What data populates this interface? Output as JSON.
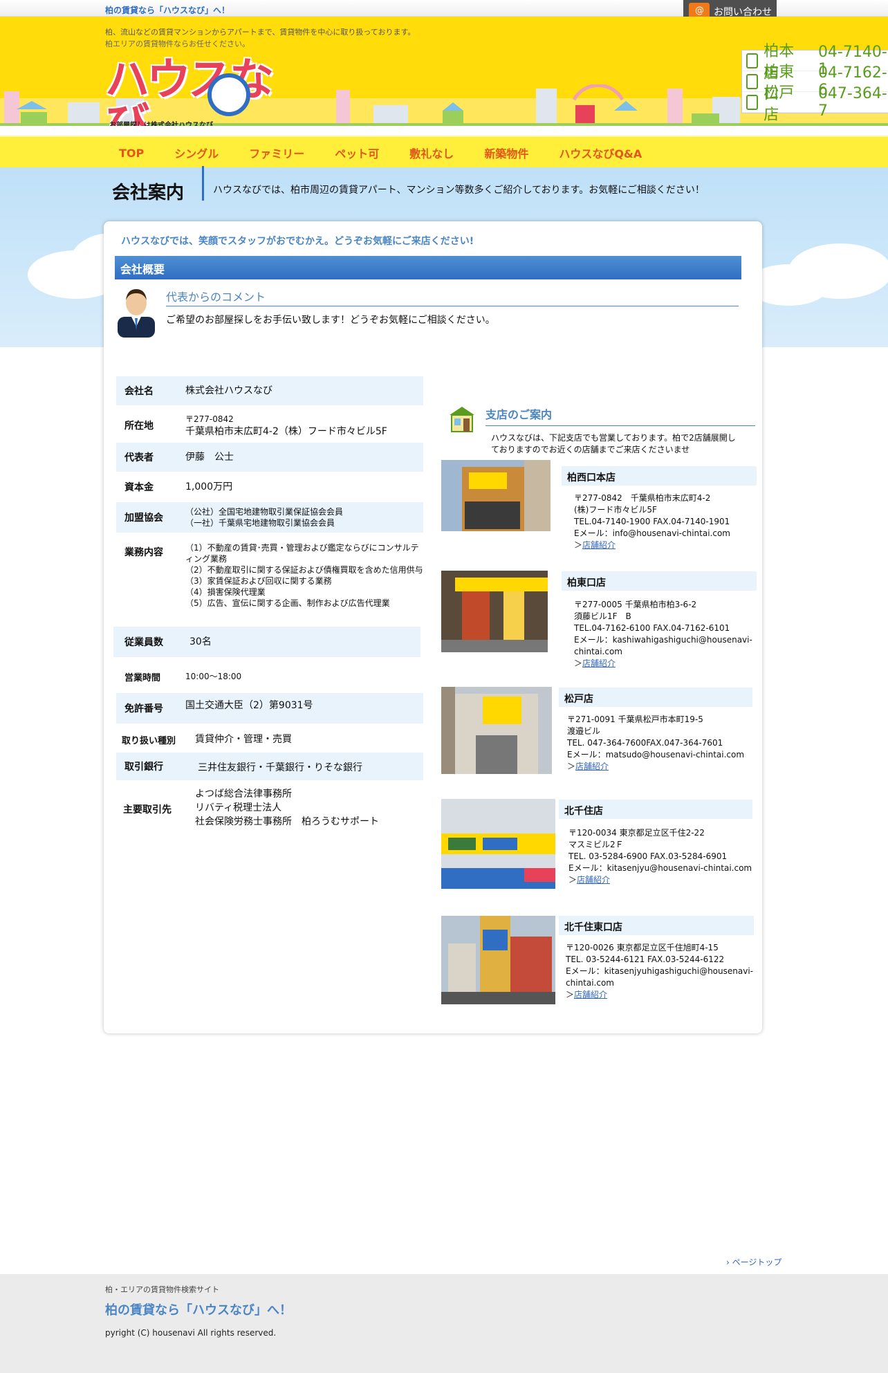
{
  "top": {
    "tagline": "柏の賃貸なら「ハウスなび」へ！",
    "contact_label": "お問い合わせ"
  },
  "header": {
    "desc1": "柏、流山などの賃貸マンションからアパートまで、賃貸物件を中心に取り扱っております。",
    "desc2": "柏エリアの賃貸物件ならお任せください。",
    "logo_text": "ハウスなび",
    "logo_sub": "お部屋探しは株式会社ハウスなび",
    "phones": [
      {
        "store": "柏本店",
        "tel": "04-7140-1"
      },
      {
        "store": "柏東口",
        "tel": "04-7162-6"
      },
      {
        "store": "松戸店",
        "tel": "047-364-7"
      }
    ]
  },
  "nav": [
    "TOP",
    "シングル",
    "ファミリー",
    "ペット可",
    "敷礼なし",
    "新築物件",
    "ハウスなびQ&A"
  ],
  "page": {
    "title": "会社案内",
    "desc": "ハウスなびでは、柏市周辺の賃貸アパート、マンション等数多くご紹介しております。お気軽にご相談ください！",
    "welcome": "ハウスなびでは、笑顔でスタッフがおでむかえ。どうぞお気軽にご来店ください!",
    "section": "会社概要"
  },
  "comment": {
    "title": "代表からのコメント",
    "text": "ご希望のお部屋探しをお手伝い致します！どうぞお気軽にご相談ください。"
  },
  "company": {
    "name_k": "会社名",
    "name_v": "株式会社ハウスなび",
    "addr_k": "所在地",
    "addr_zip": "〒277-0842",
    "addr_v": "千葉県柏市末広町4-2（株）フード市々ビル5F",
    "rep_k": "代表者",
    "rep_v": "伊藤　公士",
    "cap_k": "資本金",
    "cap_v": "1,000万円",
    "assoc_k": "加盟協会",
    "assoc_v1": "（公社）全国宅地建物取引業保証協会会員",
    "assoc_v2": "（一社）千葉県宅地建物取引業協会会員",
    "biz_k": "業務内容",
    "biz_v": [
      "（1）不動産の賃貸･売買・管理および鑑定ならびにコンサルティング業務",
      "（2）不動産取引に関する保証および債権買取を含めた信用供与",
      "（3）家賃保証および回収に関する業務",
      "（4）損害保険代理業",
      "（5）広告、宣伝に関する企画、制作および広告代理業"
    ],
    "emp_k": "従業員数",
    "emp_v": "30名",
    "hours_k": "営業時間",
    "hours_v": "10:00〜18:00",
    "lic_k": "免許番号",
    "lic_v": "国土交通大臣（2）第9031号",
    "type_k": "取り扱い種別",
    "type_v": "賃貸仲介・管理・売買",
    "bank_k": "取引銀行",
    "bank_v": "三井住友銀行・千葉銀行・りそな銀行",
    "partner_k": "主要取引先",
    "partner_v": [
      "よつば総合法律事務所",
      "リバティ税理士法人",
      "社会保険労務士事務所　柏ろうむサポート"
    ]
  },
  "branches": {
    "title": "支店のご案内",
    "desc": "ハウスなびは、下記支店でも営業しております。柏で2店舗展開しておりますのでお近くの店舗までご来店くださいませ",
    "items": [
      {
        "name": "柏西口本店",
        "lines": [
          "〒277-0842　千葉県柏市末広町4-2",
          "(株)フード市々ビル5F",
          "TEL.04-7140-1900 FAX.04-7140-1901",
          "Eメール：info@housenavi-chintai.com"
        ],
        "link": "店舗紹介"
      },
      {
        "name": "柏東口店",
        "lines": [
          "〒277-0005 千葉県柏市柏3-6-2",
          "須藤ビル1F　B",
          "TEL.04-7162-6100 FAX.04-7162-6101",
          "Eメール：kashiwahigashiguchi@housenavi-chintai.com"
        ],
        "link": "店舗紹介"
      },
      {
        "name": "松戸店",
        "lines": [
          "〒271-0091 千葉県松戸市本町19-5",
          "渡邉ビル",
          "TEL. 047-364-7600FAX.047-364-7601",
          "Eメール：matsudo@housenavi-chintai.com"
        ],
        "link": "店舗紹介"
      },
      {
        "name": "北千住店",
        "lines": [
          "〒120-0034 東京都足立区千住2-22",
          "マスミビル2Ｆ",
          "TEL. 03-5284-6900 FAX.03-5284-6901",
          "Eメール：kitasenjyu@housenavi-chintai.com"
        ],
        "link": "店舗紹介"
      },
      {
        "name": "北千住東口店",
        "lines": [
          "〒120-0026 東京都足立区千住旭町4-15",
          "TEL. 03-5244-6121 FAX.03-5244-6122",
          "Eメール：kitasenjyuhigashiguchi@housenavi-chintai.com"
        ],
        "link": "店舗紹介"
      }
    ]
  },
  "footer": {
    "pagetop": "ページトップ",
    "line1": "柏・エリアの賃貸物件検索サイト",
    "line2": "柏の賃貸なら「ハウスなび」へ！",
    "copy": "pyright (C) housenavi All rights reserved."
  },
  "colors": {
    "header_yellow": "#ffdc0a",
    "nav_yellow": "#ffef3a",
    "nav_text": "#e3571a",
    "accent_blue": "#2f6ec3",
    "light_blue": "#e8f3fc"
  }
}
